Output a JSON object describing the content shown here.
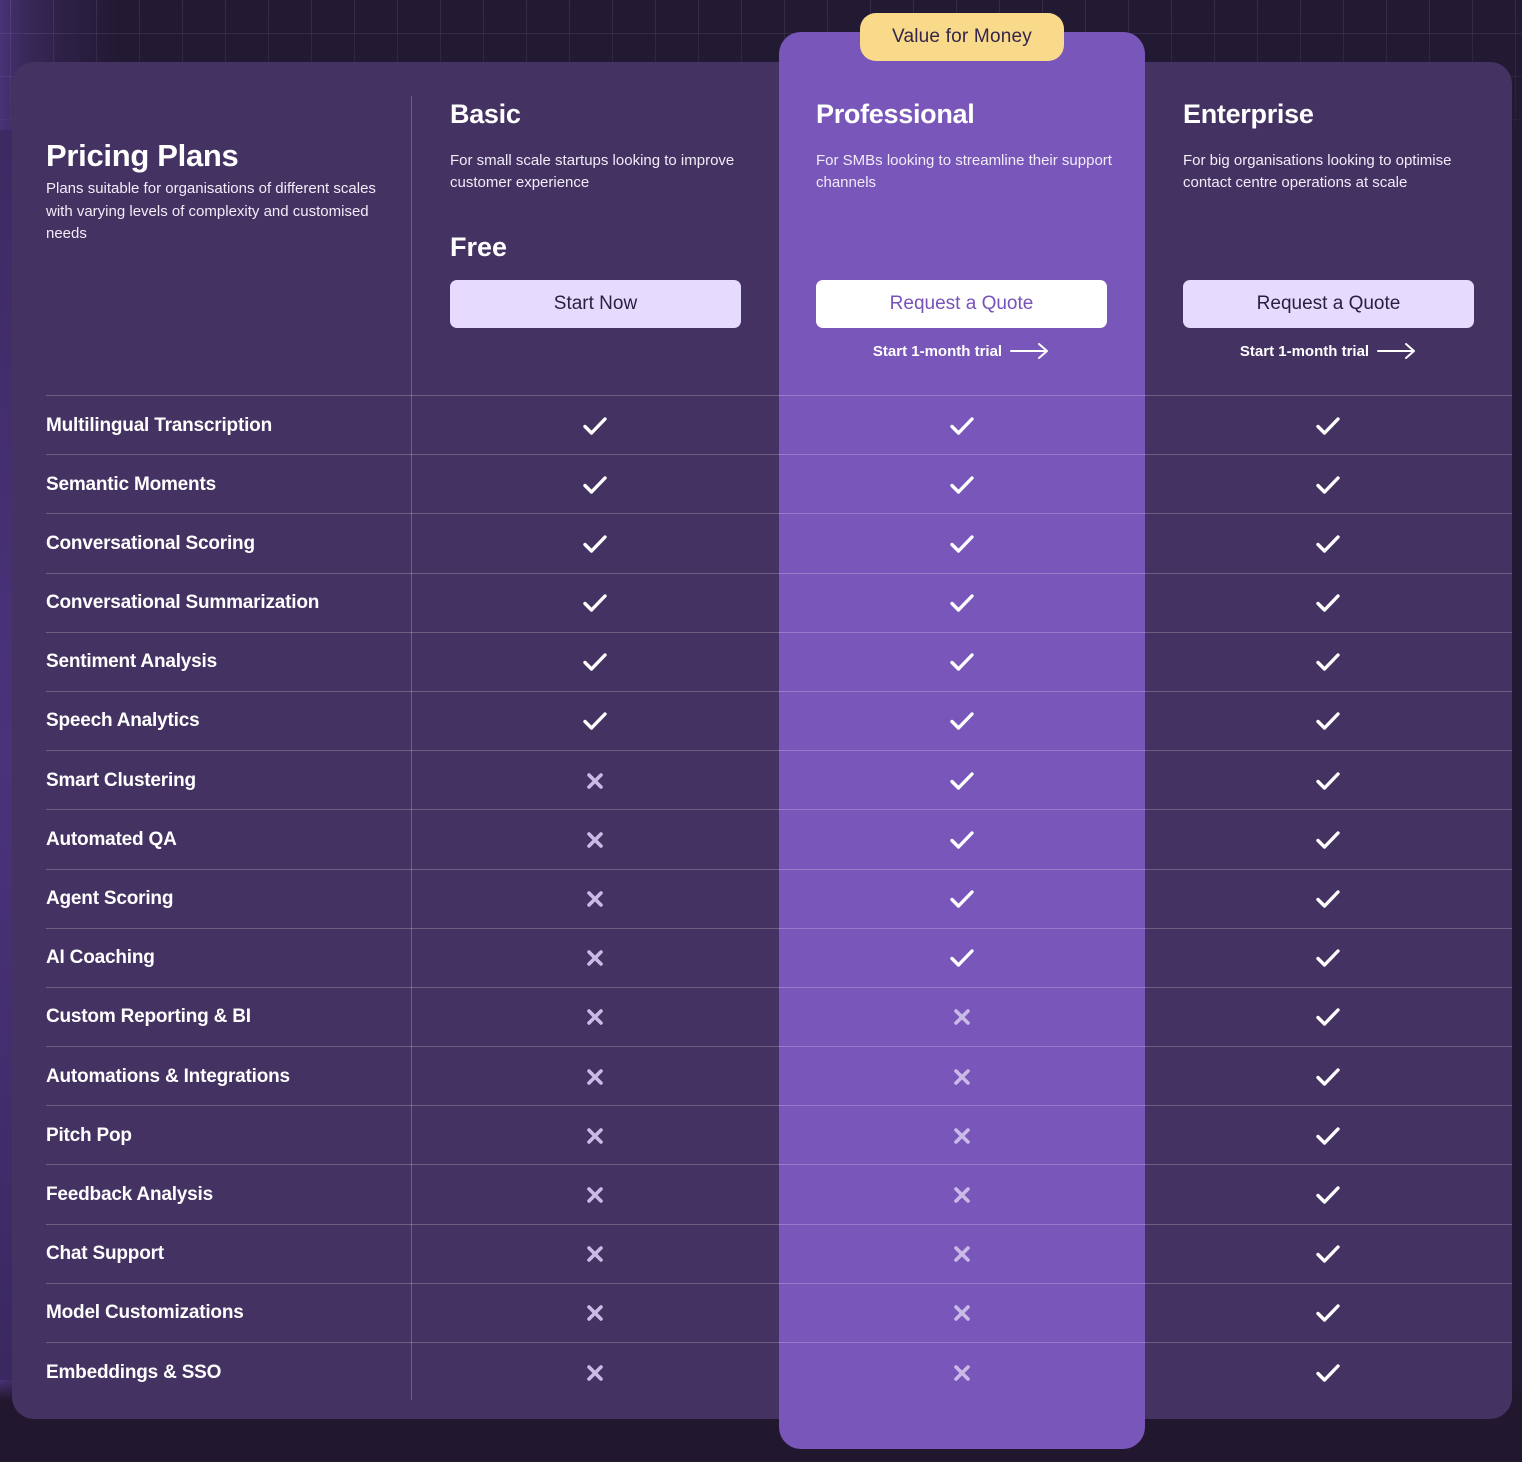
{
  "header": {
    "title": "Pricing Plans",
    "subtitle": "Plans suitable for organisations of different scales with varying levels of complexity and customised needs"
  },
  "badge": {
    "label": "Value for Money"
  },
  "colors": {
    "background": "#221933",
    "card": "#443262",
    "highlight": "#7956ba",
    "badge": "#f9d98a",
    "button_light": "#e6daff",
    "button_white": "#ffffff",
    "cross": "#c9bbe6"
  },
  "plans": [
    {
      "name": "Basic",
      "description": "For small scale startups looking to improve customer experience",
      "price": "Free",
      "cta_label": "Start Now",
      "trial_label": ""
    },
    {
      "name": "Professional",
      "description": "For SMBs looking to streamline their support channels",
      "price": "",
      "cta_label": "Request a Quote",
      "trial_label": "Start 1-month trial"
    },
    {
      "name": "Enterprise",
      "description": "For big organisations looking to optimise contact centre operations at scale",
      "price": "",
      "cta_label": "Request a Quote",
      "trial_label": "Start 1-month trial"
    }
  ],
  "features": [
    {
      "name": "Multilingual Transcription",
      "availability": [
        true,
        true,
        true
      ]
    },
    {
      "name": "Semantic Moments",
      "availability": [
        true,
        true,
        true
      ]
    },
    {
      "name": "Conversational Scoring",
      "availability": [
        true,
        true,
        true
      ]
    },
    {
      "name": "Conversational Summarization",
      "availability": [
        true,
        true,
        true
      ]
    },
    {
      "name": "Sentiment Analysis",
      "availability": [
        true,
        true,
        true
      ]
    },
    {
      "name": "Speech Analytics",
      "availability": [
        true,
        true,
        true
      ]
    },
    {
      "name": "Smart Clustering",
      "availability": [
        false,
        true,
        true
      ]
    },
    {
      "name": "Automated QA",
      "availability": [
        false,
        true,
        true
      ]
    },
    {
      "name": "Agent Scoring",
      "availability": [
        false,
        true,
        true
      ]
    },
    {
      "name": "AI Coaching",
      "availability": [
        false,
        true,
        true
      ]
    },
    {
      "name": "Custom Reporting & BI",
      "availability": [
        false,
        false,
        true
      ]
    },
    {
      "name": "Automations & Integrations",
      "availability": [
        false,
        false,
        true
      ]
    },
    {
      "name": "Pitch Pop",
      "availability": [
        false,
        false,
        true
      ]
    },
    {
      "name": "Feedback Analysis",
      "availability": [
        false,
        false,
        true
      ]
    },
    {
      "name": "Chat Support",
      "availability": [
        false,
        false,
        true
      ]
    },
    {
      "name": "Model Customizations",
      "availability": [
        false,
        false,
        true
      ]
    },
    {
      "name": "Embeddings & SSO",
      "availability": [
        false,
        false,
        true
      ]
    }
  ],
  "icons": {
    "available": "check-icon",
    "unavailable": "cross-icon",
    "trial_arrow": "arrow-right-icon"
  }
}
